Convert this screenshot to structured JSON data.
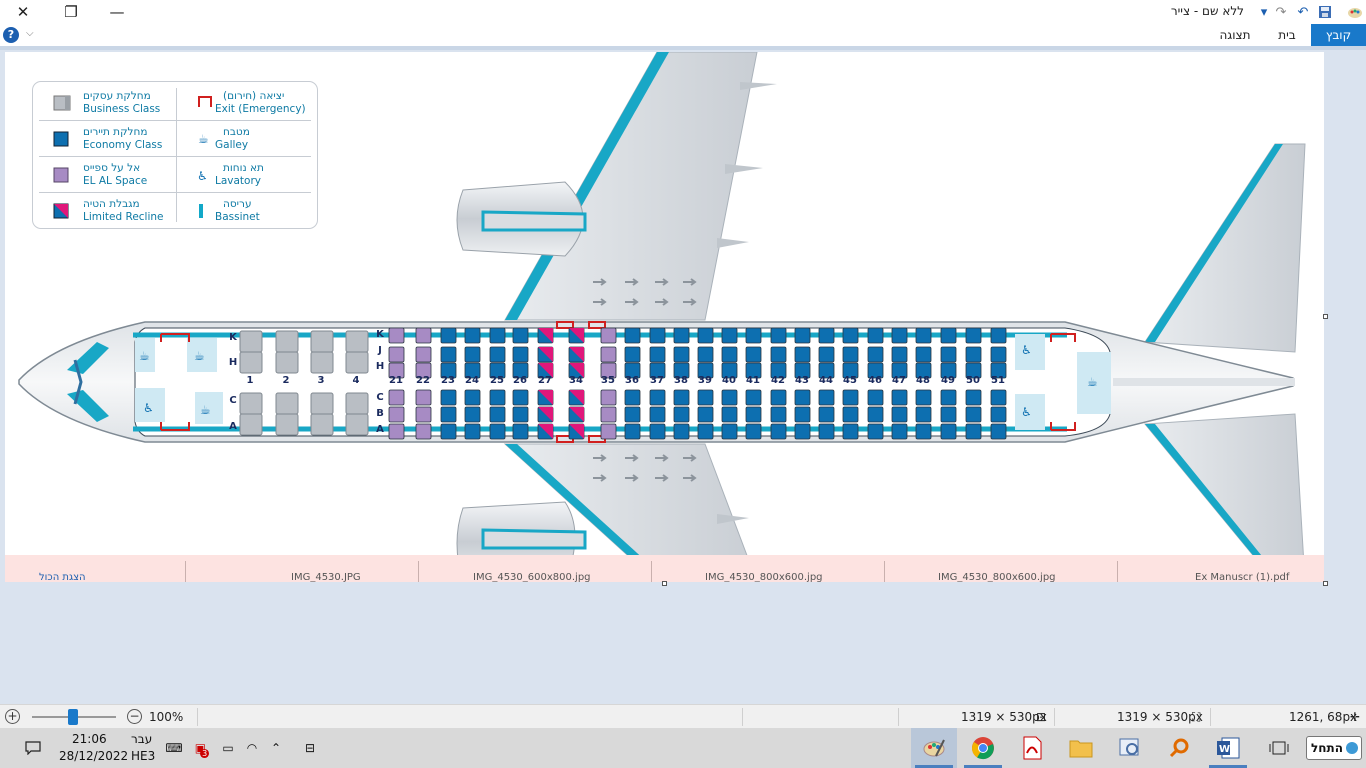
{
  "window": {
    "title": "ללא שם - צייר",
    "controls": [
      "close",
      "maximize",
      "minimize"
    ]
  },
  "ribbon": {
    "tabs": [
      {
        "label": "קובץ",
        "active": true
      },
      {
        "label": "בית",
        "active": false
      },
      {
        "label": "תצוגה",
        "active": false
      }
    ]
  },
  "legend": [
    {
      "he": "יציאה (חירום)",
      "en": "Exit (Emergency)",
      "icon": "exit-icon"
    },
    {
      "he": "מחלקת עסקים",
      "en": "Business Class",
      "icon": "business-seat-icon"
    },
    {
      "he": "מטבח",
      "en": "Galley",
      "icon": "galley-icon"
    },
    {
      "he": "מחלקת תיירים",
      "en": "Economy Class",
      "icon": "economy-seat-icon"
    },
    {
      "he": "תא נוחות",
      "en": "Lavatory",
      "icon": "lavatory-icon"
    },
    {
      "he": "אל על ספייס",
      "en": "EL AL Space",
      "icon": "space-seat-icon"
    },
    {
      "he": "עריסה",
      "en": "Bassinet",
      "icon": "bassinet-icon"
    },
    {
      "he": "מגבלת הטיה",
      "en": "Limited Recline",
      "icon": "limited-recline-icon"
    }
  ],
  "seatmap": {
    "rows": [
      "1",
      "2",
      "3",
      "4",
      "21",
      "22",
      "23",
      "24",
      "25",
      "26",
      "27",
      "34",
      "35",
      "36",
      "37",
      "38",
      "39",
      "40",
      "41",
      "42",
      "43",
      "44",
      "45",
      "46",
      "47",
      "48",
      "49",
      "50",
      "51"
    ],
    "row_classes": [
      "business",
      "business",
      "business",
      "business",
      "space",
      "space",
      "economy",
      "economy",
      "economy",
      "economy",
      "limited",
      "limited",
      "space",
      "economy",
      "economy",
      "economy",
      "economy",
      "economy",
      "economy",
      "economy",
      "economy",
      "economy",
      "economy",
      "economy",
      "economy",
      "economy",
      "economy",
      "economy",
      "economy"
    ],
    "business_seat_letters_upper": [
      "K",
      "H"
    ],
    "business_seat_letters_lower": [
      "C",
      "A"
    ],
    "seat_letters_upper": [
      "K",
      "J",
      "H"
    ],
    "seat_letters_lower": [
      "C",
      "B",
      "A"
    ],
    "colors": {
      "economy": "#0d6fb0",
      "business": "#b9bec4",
      "space": "#a78bc4",
      "limited_pink": "#e0177a",
      "accent": "#12a8c8",
      "exit": "#d0201f",
      "label": "#1a2a5e"
    }
  },
  "file_strip": [
    {
      "label": "הצגת הכול"
    },
    {
      "label": "IMG_4530.JPG"
    },
    {
      "label": "IMG_4530_600x800.jpg"
    },
    {
      "label": "IMG_4530_800x600.jpg"
    },
    {
      "label": "IMG_4530_800x600.jpg"
    },
    {
      "label": "Ex Manuscr (1).pdf"
    }
  ],
  "statusbar": {
    "zoom": "100%",
    "selection_size": "1319 × 530px",
    "image_size": "1319 × 530px",
    "cursor": "1261, 68px"
  },
  "taskbar": {
    "start": "התחל",
    "time": "21:06",
    "date": "28/12/2022",
    "lang_top": "עבר",
    "lang_bottom": "HE3",
    "notification_badge": "3",
    "apps": [
      "start-icon",
      "search-icon",
      "word-icon",
      "search-magnifier-icon",
      "explorer-icon",
      "pdf-icon",
      "chrome-icon",
      "paint-icon"
    ]
  }
}
